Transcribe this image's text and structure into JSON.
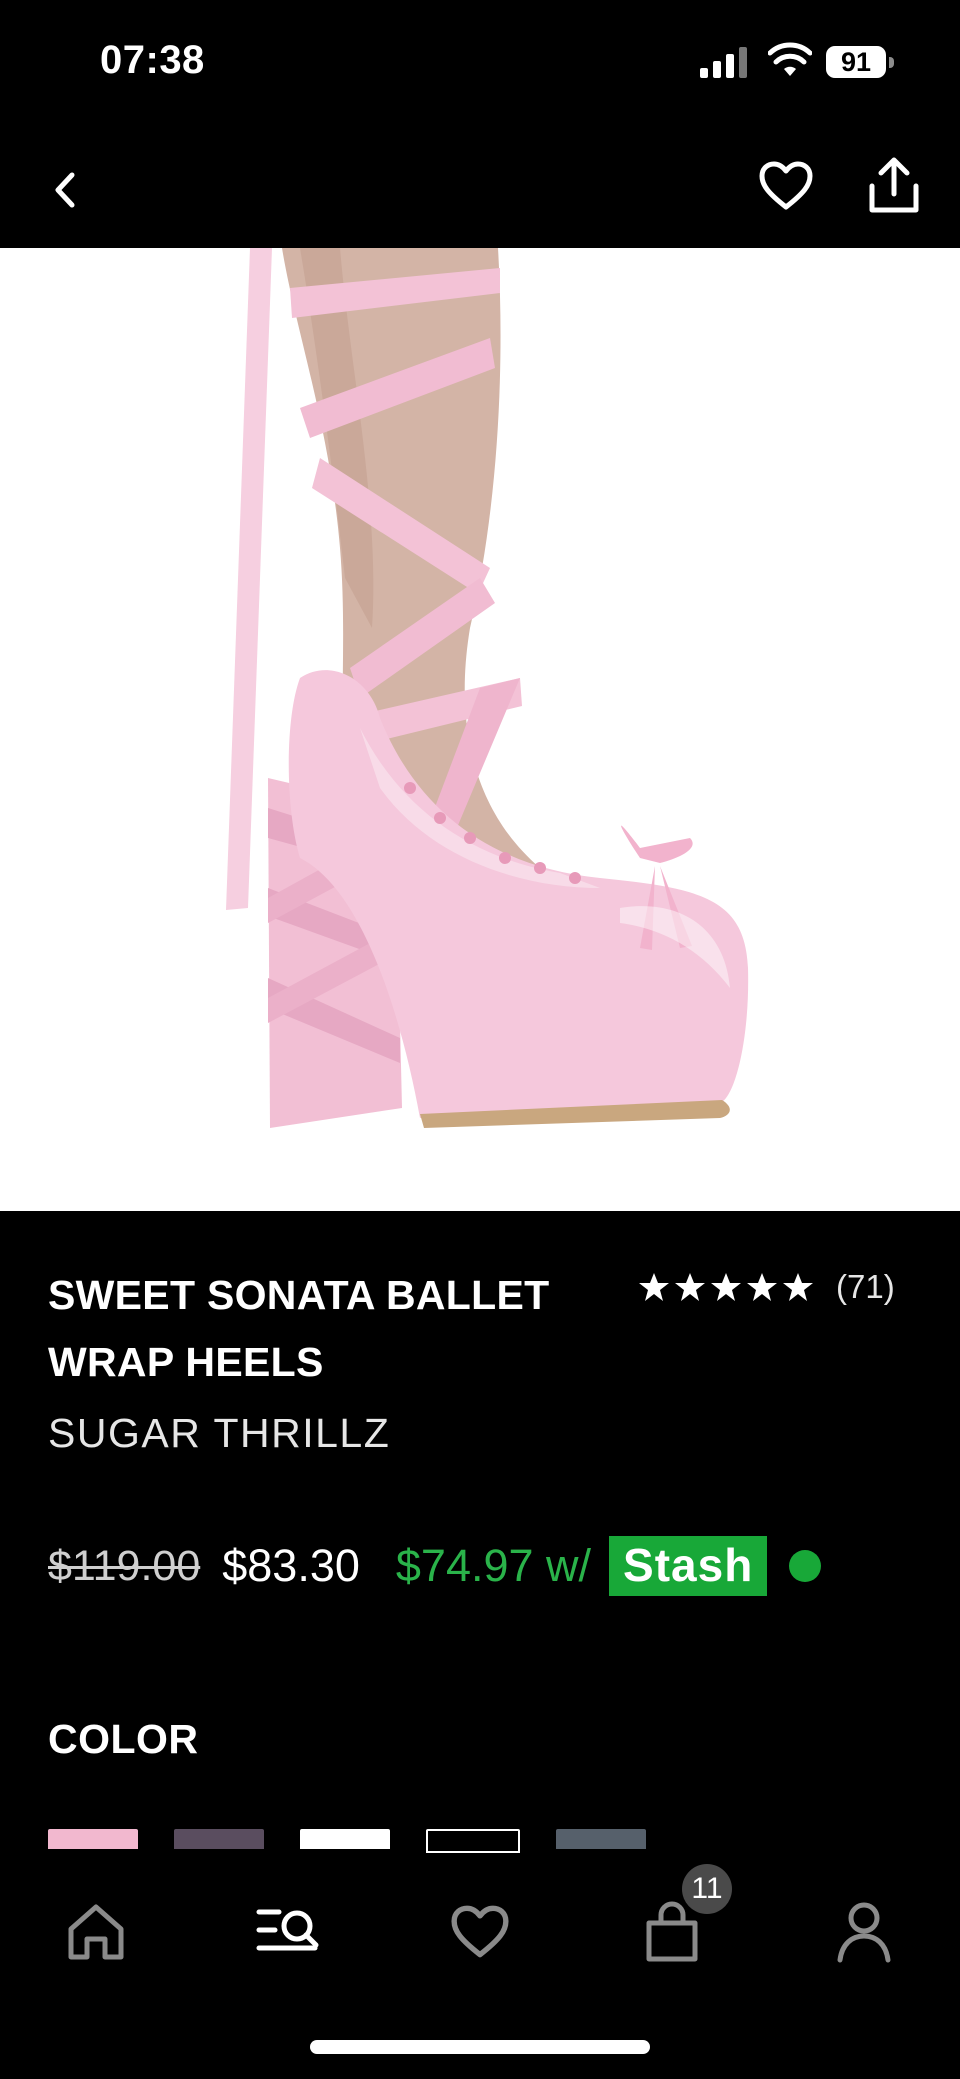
{
  "status_bar": {
    "time": "07:38",
    "battery": "91",
    "icons": [
      "signal-icon",
      "wifi-icon",
      "battery-icon"
    ]
  },
  "header": {
    "icons": [
      "back-chevron-icon",
      "heart-outline-icon",
      "share-icon"
    ]
  },
  "gallery": {
    "slide_count": 5,
    "active_index": 0
  },
  "product": {
    "title": "SWEET SONATA BALLET WRAP HEELS",
    "brand": "SUGAR THRILLZ",
    "rating": {
      "stars": 5,
      "count": "(71)"
    },
    "price": {
      "original": "$119.00",
      "sale": "$83.30",
      "stash_price": "$74.97 w/",
      "stash_label": "Stash"
    }
  },
  "color_section": {
    "heading": "COLOR",
    "swatches": [
      "#f2b8cf",
      "#5a4d5f",
      "#ffffff",
      "#000000",
      "#56606b"
    ]
  },
  "tab_bar": {
    "items": [
      "home-icon",
      "search-menu-icon",
      "wishlist-icon",
      "cart-icon",
      "account-icon"
    ],
    "cart_badge": "11"
  },
  "colors": {
    "background": "#000000",
    "stash_green": "#18a838",
    "stash_price_green": "#2ab34a",
    "shoe_pink": "#f4c4d8"
  }
}
